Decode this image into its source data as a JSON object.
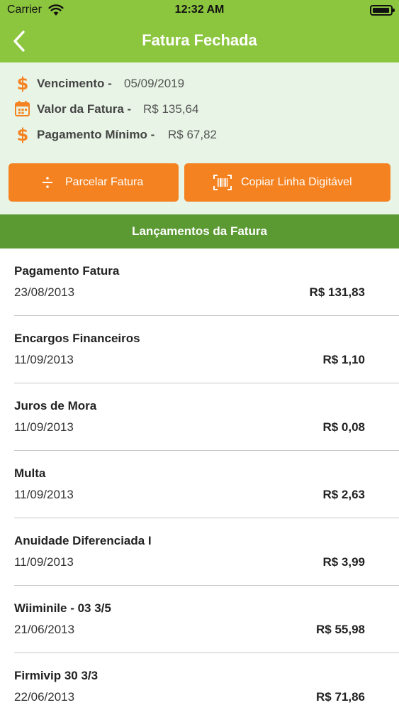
{
  "status_bar": {
    "carrier": "Carrier",
    "time": "12:32 AM"
  },
  "header": {
    "title": "Fatura Fechada",
    "color": "#8cc63f"
  },
  "summary": {
    "due": {
      "label": "Vencimento -",
      "value": "05/09/2019",
      "icon": "dollar-icon"
    },
    "amount": {
      "label": "Valor da Fatura -",
      "value": "R$ 135,64",
      "icon": "calendar-icon"
    },
    "minimum": {
      "label": "Pagamento Mínimo -",
      "value": "R$ 67,82",
      "icon": "dollar-icon"
    }
  },
  "actions": {
    "split": {
      "label": "Parcelar Fatura",
      "icon": "divide-icon"
    },
    "copy_barcode": {
      "label": "Copiar Linha Digitável",
      "icon": "barcode-icon"
    },
    "color": "#f58220"
  },
  "section": {
    "title": "Lançamentos da Fatura",
    "color": "#5b9a33"
  },
  "transactions": [
    {
      "description": "Pagamento Fatura",
      "date": "23/08/2013",
      "amount": "R$ 131,83"
    },
    {
      "description": "Encargos Financeiros",
      "date": "11/09/2013",
      "amount": "R$ 1,10"
    },
    {
      "description": "Juros de Mora",
      "date": "11/09/2013",
      "amount": "R$ 0,08"
    },
    {
      "description": "Multa",
      "date": "11/09/2013",
      "amount": "R$ 2,63"
    },
    {
      "description": "Anuidade Diferenciada I",
      "date": "11/09/2013",
      "amount": "R$ 3,99"
    },
    {
      "description": "Wiiminile - 03 3/5",
      "date": "21/06/2013",
      "amount": "R$ 55,98"
    },
    {
      "description": "Firmivip 30 3/3",
      "date": "22/06/2013",
      "amount": "R$ 71,86"
    }
  ]
}
